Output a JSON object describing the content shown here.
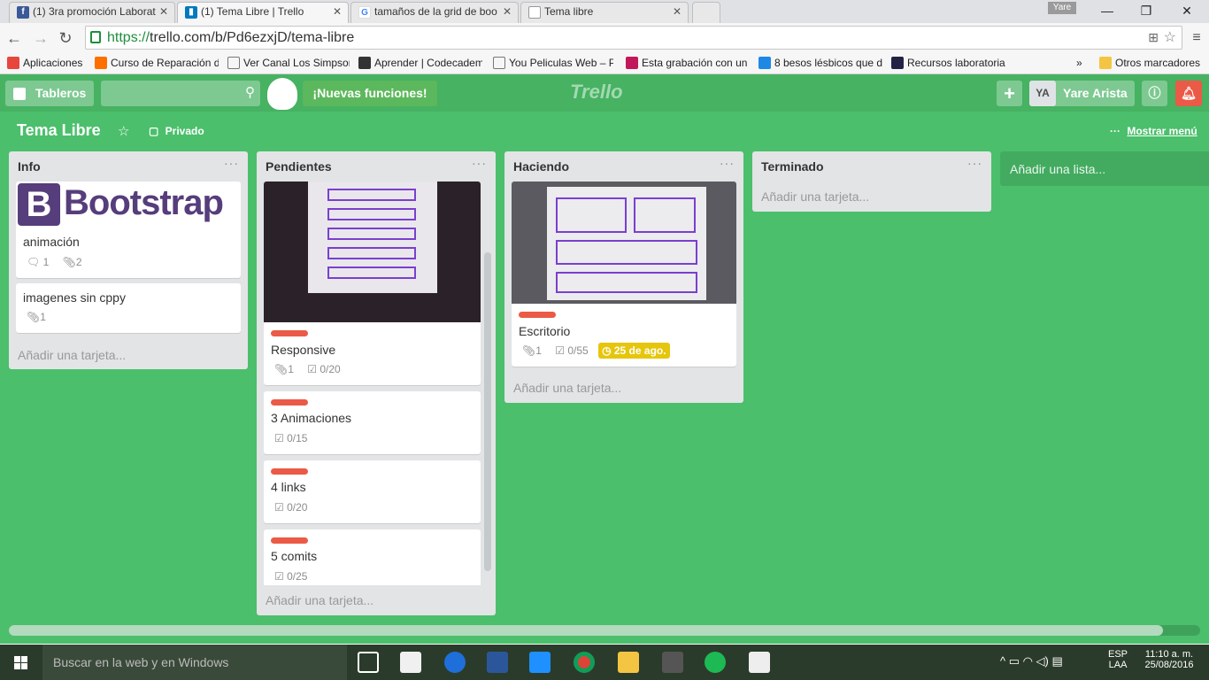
{
  "browser": {
    "tabs": [
      {
        "title": "(1) 3ra promoción Laborat",
        "icon": "facebook-icon",
        "color": "#3b5998"
      },
      {
        "title": "(1) Tema Libre | Trello",
        "icon": "trello-icon",
        "color": "#0079bf"
      },
      {
        "title": "tamaños de la grid de boo",
        "icon": "google-icon",
        "color": "#4285f4"
      },
      {
        "title": "Tema libre",
        "icon": "page-icon",
        "color": "#999999"
      }
    ],
    "user_chip": "Yare",
    "url_https": "https://",
    "url_rest": "trello.com/b/Pd6ezxjD/tema-libre",
    "bookmarks": [
      {
        "label": "Aplicaciones",
        "color": "#e8453c"
      },
      {
        "label": "Curso de Reparación d",
        "color": "#ff6f00"
      },
      {
        "label": "Ver Canal Los Simpsons",
        "color": "#777777"
      },
      {
        "label": "Aprender | Codecadem",
        "color": "#333333"
      },
      {
        "label": "You Peliculas Web – Pe",
        "color": "#777777"
      },
      {
        "label": "Esta grabación con un",
        "color": "#c2185b"
      },
      {
        "label": "8 besos lésbicos que d",
        "color": "#1e88e5"
      },
      {
        "label": "Recursos laboratoria",
        "color": "#222244"
      }
    ],
    "bookmarks_more": "»",
    "other_bookmarks": "Otros marcadores"
  },
  "trello": {
    "boards_button": "Tableros",
    "new_features": "¡Nuevas funciones!",
    "logo": "Trello",
    "user_initials": "YA",
    "user_name": "Yare Arista",
    "board_title": "Tema Libre",
    "privacy": "Privado",
    "show_menu": "Mostrar menú",
    "add_list": "Añadir una lista...",
    "add_card": "Añadir una tarjeta...",
    "lists": [
      {
        "title": "Info",
        "cards": [
          {
            "cover_text": "Bootstrap",
            "cover_letter": "B",
            "title": "animación",
            "comments": "1",
            "attachments": "2"
          },
          {
            "title": "imagenes sin cppy",
            "attachments": "1"
          }
        ]
      },
      {
        "title": "Pendientes",
        "cards": [
          {
            "title": "Responsive",
            "attachments": "1",
            "checklist": "0/20"
          },
          {
            "title": "3 Animaciones",
            "checklist": "0/15"
          },
          {
            "title": "4 links",
            "checklist": "0/20"
          },
          {
            "title": "5 comits",
            "checklist": "0/25"
          }
        ]
      },
      {
        "title": "Haciendo",
        "cards": [
          {
            "title": "Escritorio",
            "attachments": "1",
            "checklist": "0/55",
            "due": "25 de ago."
          }
        ]
      },
      {
        "title": "Terminado",
        "cards": []
      }
    ]
  },
  "taskbar": {
    "search_placeholder": "Buscar en la web y en Windows",
    "lang": "ESP",
    "lang2": "LAA",
    "time": "11:10 a. m.",
    "date": "25/08/2016"
  }
}
